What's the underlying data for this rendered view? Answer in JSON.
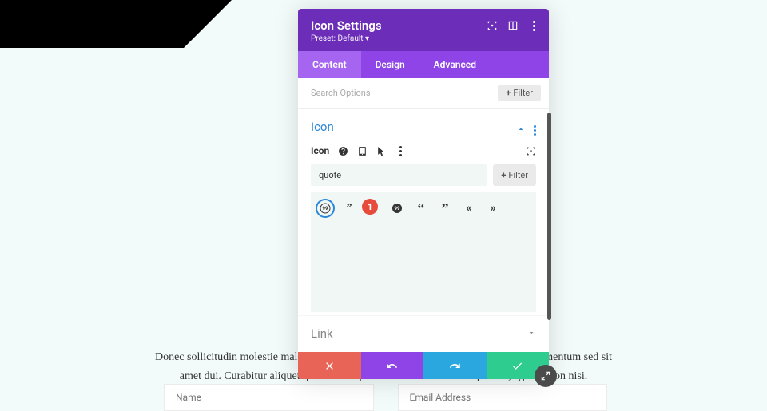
{
  "header": {
    "title": "Icon Settings",
    "preset": "Preset: Default ▾"
  },
  "tabs": {
    "content": "Content",
    "design": "Design",
    "advanced": "Advanced"
  },
  "search": {
    "placeholder": "Search Options",
    "filter": "Filter"
  },
  "icon_section": {
    "title": "Icon",
    "field_label": "Icon",
    "search_value": "quote",
    "filter": "Filter",
    "badge": "1"
  },
  "link_section": {
    "title": "Link"
  },
  "body_text": "Donec sollicitudin molestie malesuada. Vestibulum ac diam sit amet quam vehicula elementum sed sit amet dui. Curabitur aliquet quam id dui posuere blandit. Pellentesque nec, egestas non nisi.",
  "form": {
    "name": "Name",
    "email": "Email Address"
  }
}
